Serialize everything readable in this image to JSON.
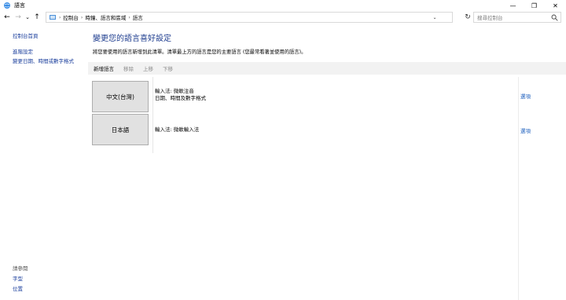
{
  "window": {
    "title": "語言",
    "minimize_glyph": "—",
    "maximize_glyph": "❐",
    "close_glyph": "✕"
  },
  "nav": {
    "back_glyph": "←",
    "forward_glyph": "→",
    "recent_glyph": "⌄",
    "up_glyph": "↑",
    "refresh_glyph": "↻"
  },
  "breadcrumb": [
    "控制台",
    "時鐘、語言和區域",
    "語言"
  ],
  "search": {
    "placeholder": "搜尋控制台"
  },
  "sidebar": {
    "home": "控制台首頁",
    "links": [
      "進階設定",
      "變更日期、時間或數字格式"
    ],
    "see_also_label": "請參閱",
    "see_also": [
      "字型",
      "位置"
    ]
  },
  "main": {
    "title": "變更您的語言喜好設定",
    "description": "將您要使用的語言新增到此清單。清單最上方的語言是您的主要語言 (您最常看著並使用的語言)。"
  },
  "toolbar": {
    "add": "新增語言",
    "remove": "移除",
    "up": "上移",
    "down": "下移"
  },
  "languages": [
    {
      "name": "中文(台灣)",
      "lines": [
        "輸入法: 微軟注音",
        "日期、時間及數字格式"
      ],
      "option": "選項"
    },
    {
      "name": "日本語",
      "lines": [
        "輸入法: 微軟輸入法"
      ],
      "option": "選項"
    }
  ]
}
